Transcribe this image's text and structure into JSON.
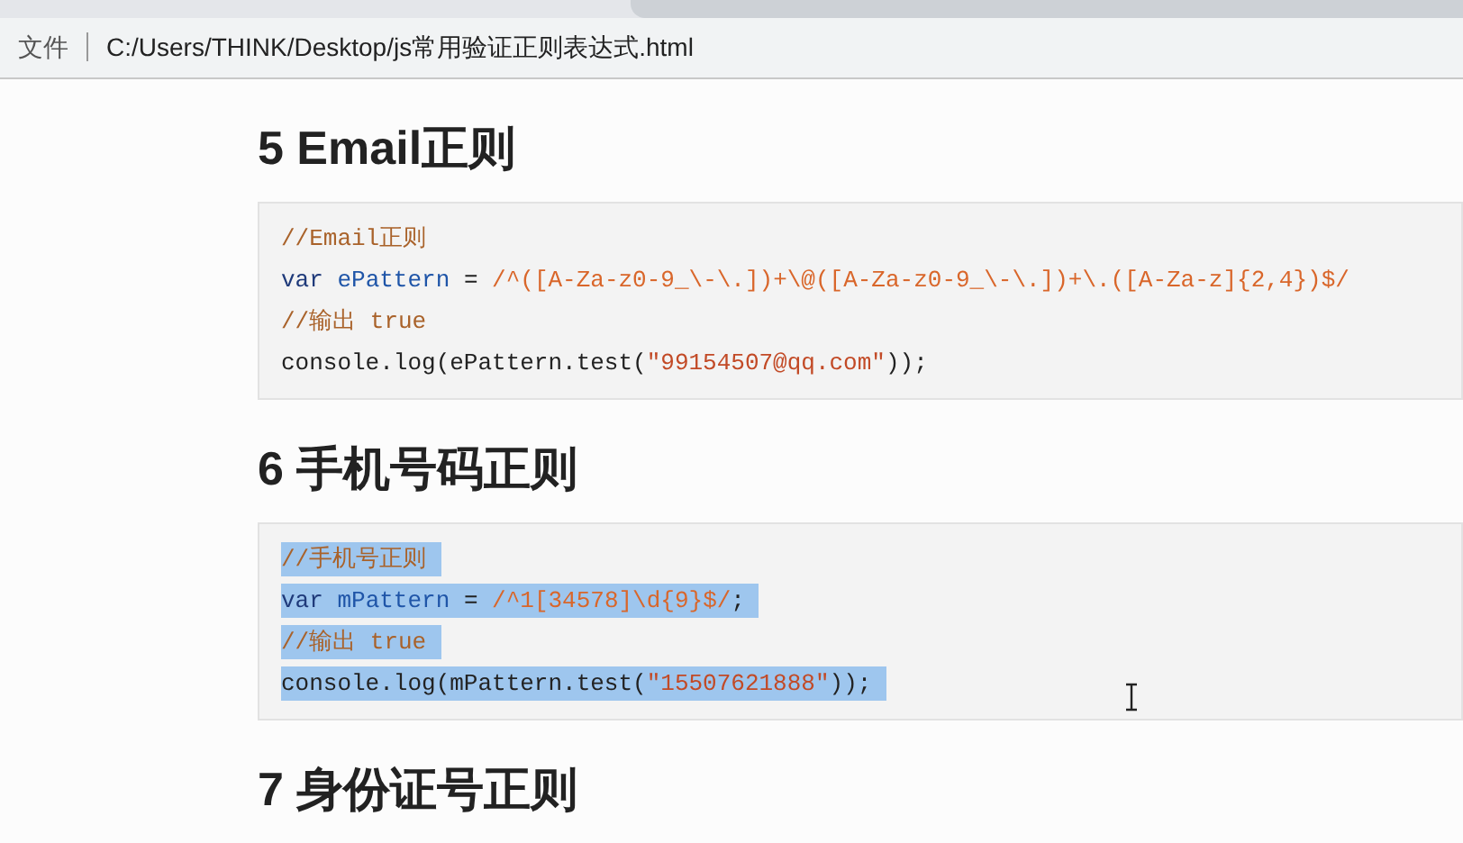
{
  "address_bar": {
    "scheme_label": "文件",
    "url": "C:/Users/THINK/Desktop/js常用验证正则表达式.html"
  },
  "sections": [
    {
      "heading": "5 Email正则",
      "code": [
        {
          "selected": false,
          "tokens": [
            {
              "kind": "comment",
              "text": "//Email正则"
            }
          ]
        },
        {
          "selected": false,
          "tokens": [
            {
              "kind": "keyword",
              "text": "var "
            },
            {
              "kind": "ident",
              "text": "ePattern"
            },
            {
              "kind": "plain",
              "text": " = "
            },
            {
              "kind": "regex",
              "text": "/^([A-Za-z0-9_\\-\\.])+\\@([A-Za-z0-9_\\-\\.])+\\.([A-Za-z]{2,4})$/"
            }
          ]
        },
        {
          "selected": false,
          "tokens": [
            {
              "kind": "comment",
              "text": "//输出 true"
            }
          ]
        },
        {
          "selected": false,
          "tokens": [
            {
              "kind": "plain",
              "text": "console.log(ePattern.test("
            },
            {
              "kind": "string",
              "text": "\"99154507@qq.com\""
            },
            {
              "kind": "plain",
              "text": "));"
            }
          ]
        }
      ]
    },
    {
      "heading": "6 手机号码正则",
      "code": [
        {
          "selected": true,
          "tokens": [
            {
              "kind": "comment",
              "text": "//手机号正则"
            }
          ]
        },
        {
          "selected": true,
          "tokens": [
            {
              "kind": "keyword",
              "text": "var "
            },
            {
              "kind": "ident",
              "text": "mPattern"
            },
            {
              "kind": "plain",
              "text": " = "
            },
            {
              "kind": "regex",
              "text": "/^1[34578]\\d{9}$/"
            },
            {
              "kind": "plain",
              "text": ";"
            }
          ]
        },
        {
          "selected": true,
          "tokens": [
            {
              "kind": "comment",
              "text": "//输出 true"
            }
          ]
        },
        {
          "selected": true,
          "tokens": [
            {
              "kind": "plain",
              "text": "console.log(mPattern.test("
            },
            {
              "kind": "string",
              "text": "\"15507621888\""
            },
            {
              "kind": "plain",
              "text": "));"
            }
          ]
        }
      ]
    },
    {
      "heading": "7 身份证号正则"
    }
  ]
}
